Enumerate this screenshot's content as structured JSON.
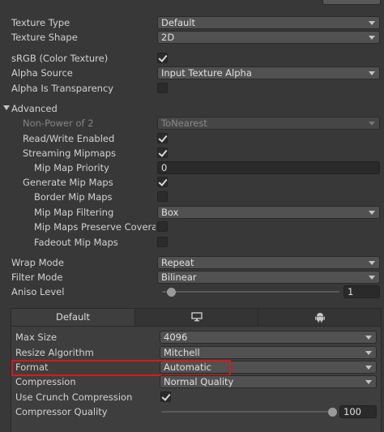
{
  "texture_type": {
    "label": "Texture Type",
    "value": "Default"
  },
  "texture_shape": {
    "label": "Texture Shape",
    "value": "2D"
  },
  "srgb": {
    "label": "sRGB (Color Texture)",
    "checked": true
  },
  "alpha_source": {
    "label": "Alpha Source",
    "value": "Input Texture Alpha"
  },
  "alpha_is_transparency": {
    "label": "Alpha Is Transparency",
    "checked": false
  },
  "advanced": {
    "label": "Advanced",
    "non_power_of_2": {
      "label": "Non-Power of 2",
      "value": "ToNearest",
      "disabled": true
    },
    "read_write": {
      "label": "Read/Write Enabled",
      "checked": true
    },
    "streaming_mipmaps": {
      "label": "Streaming Mipmaps",
      "checked": true
    },
    "mip_map_priority": {
      "label": "Mip Map Priority",
      "value": "0"
    },
    "generate_mip_maps": {
      "label": "Generate Mip Maps",
      "checked": true
    },
    "border_mip_maps": {
      "label": "Border Mip Maps",
      "checked": false
    },
    "mip_map_filtering": {
      "label": "Mip Map Filtering",
      "value": "Box"
    },
    "preserve_coverage": {
      "label": "Mip Maps Preserve Coverage",
      "checked": false
    },
    "fadeout_mip_maps": {
      "label": "Fadeout Mip Maps",
      "checked": false
    }
  },
  "wrap_mode": {
    "label": "Wrap Mode",
    "value": "Repeat"
  },
  "filter_mode": {
    "label": "Filter Mode",
    "value": "Bilinear"
  },
  "aniso_level": {
    "label": "Aniso Level",
    "value": "1",
    "slider_fraction": 0.0
  },
  "platform_tabs": {
    "default_label": "Default",
    "icons": [
      "monitor-icon",
      "android-icon"
    ]
  },
  "platform_settings": {
    "max_size": {
      "label": "Max Size",
      "value": "4096"
    },
    "resize_algorithm": {
      "label": "Resize Algorithm",
      "value": "Mitchell"
    },
    "format": {
      "label": "Format",
      "value": "Automatic"
    },
    "compression": {
      "label": "Compression",
      "value": "Normal Quality"
    },
    "use_crunch": {
      "label": "Use Crunch Compression",
      "checked": true
    },
    "compressor_quality": {
      "label": "Compressor Quality",
      "value": "100",
      "slider_fraction": 1.0
    }
  },
  "colors": {
    "highlight": "#d8191c",
    "background": "#383838"
  }
}
